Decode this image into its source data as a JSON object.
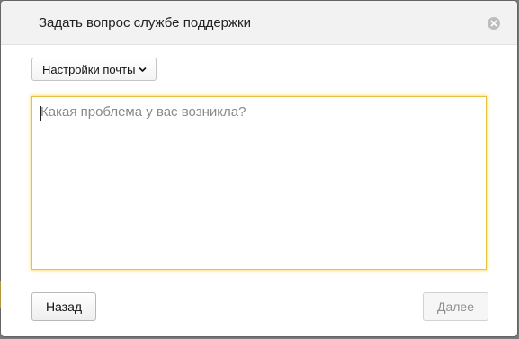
{
  "dialog": {
    "title": "Задать вопрос службе поддержки",
    "close_icon": "close-circle-icon"
  },
  "settings_dropdown": {
    "label": "Настройки почты",
    "icon": "chevron-down-icon"
  },
  "question": {
    "placeholder": "Какая проблема у вас возникла?",
    "value": ""
  },
  "footer": {
    "back_label": "Назад",
    "next_label": "Далее"
  },
  "colors": {
    "focus_border": "#e3c241",
    "header_bg": "#f2f2f2",
    "disabled_text": "#8f8f8f"
  }
}
